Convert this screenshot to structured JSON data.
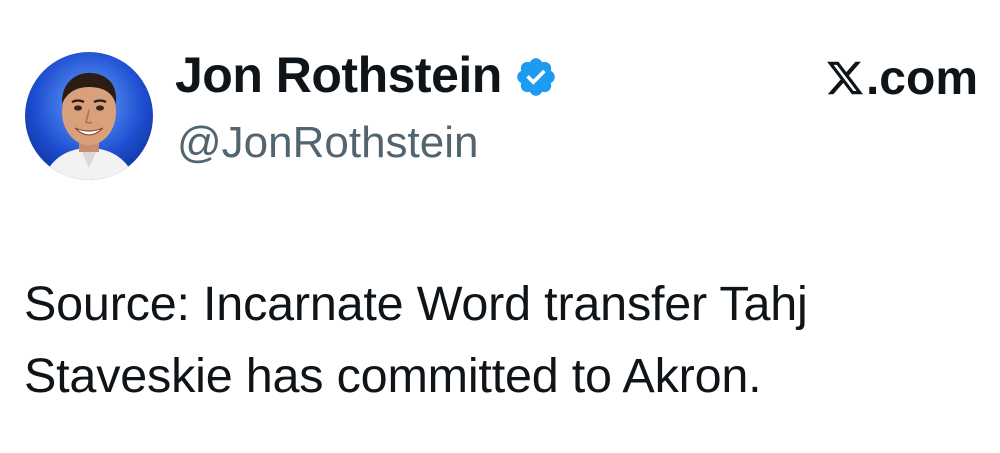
{
  "author": {
    "display_name": "Jon Rothstein",
    "handle": "@JonRothstein",
    "verified": true,
    "verified_color": "#1d9bf0",
    "avatar_icon": "profile-photo"
  },
  "source": {
    "icon": "x-logo-icon",
    "label": ".com"
  },
  "tweet": {
    "lines": [
      "Source: Incarnate Word transfer Tahj",
      "Staveskie has committed to Akron."
    ]
  }
}
